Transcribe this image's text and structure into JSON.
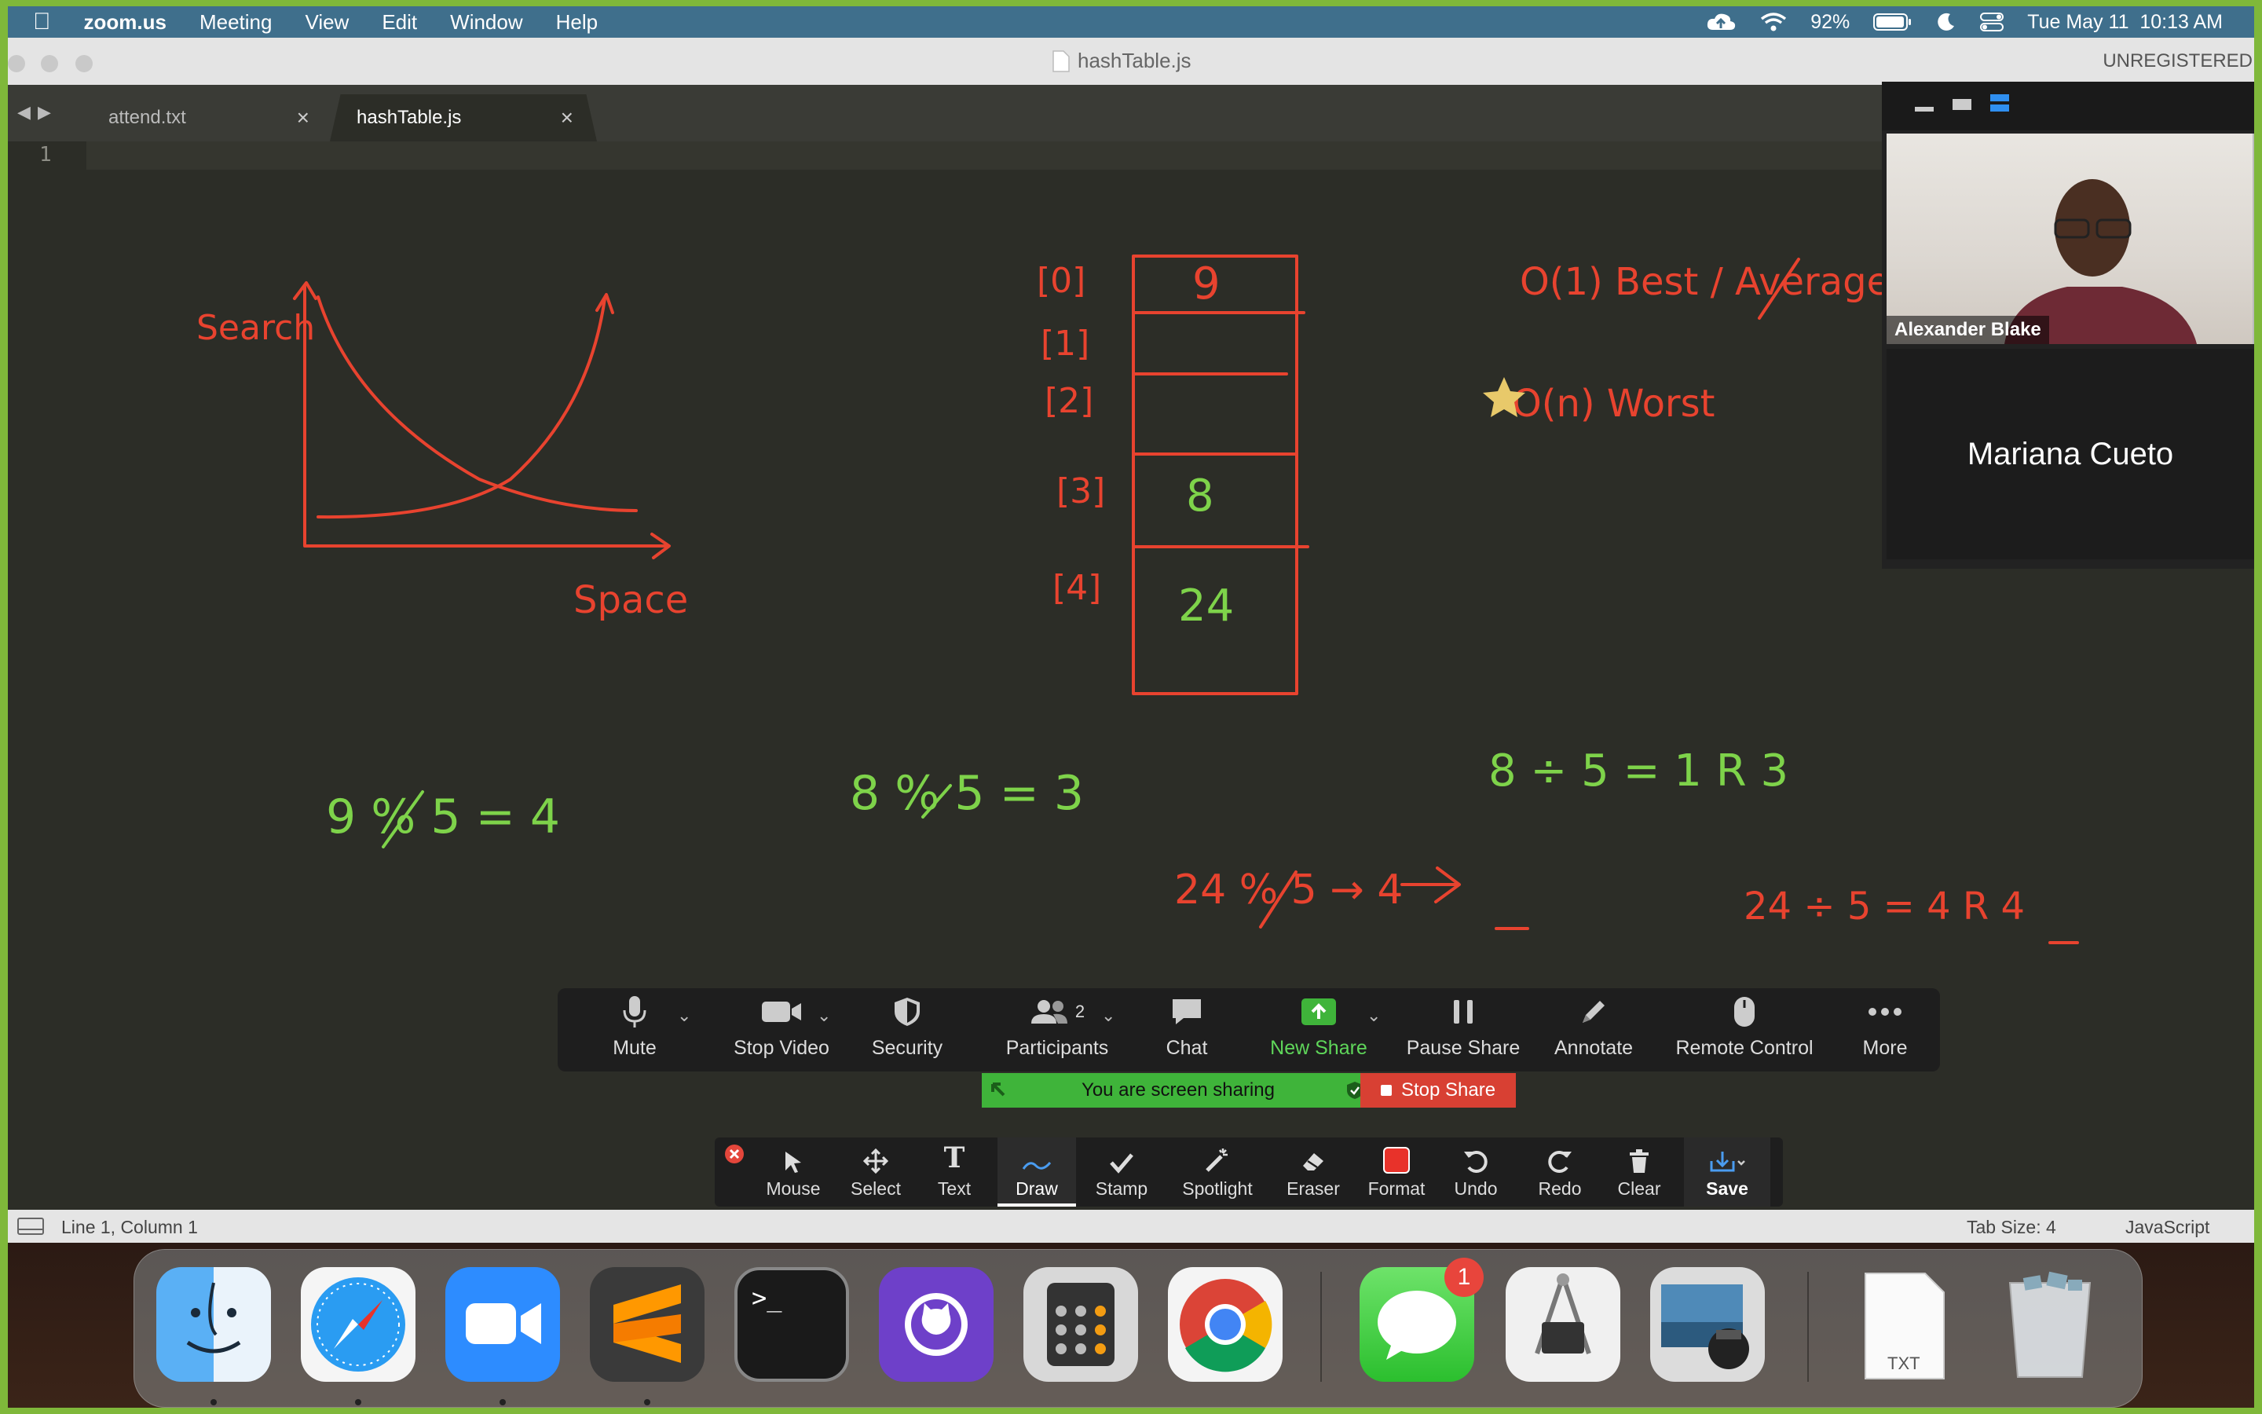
{
  "menubar": {
    "app": "zoom.us",
    "items": [
      "Meeting",
      "View",
      "Edit",
      "Window",
      "Help"
    ],
    "battery": "92%",
    "datetime": "Tue May 11  10:13 AM"
  },
  "window": {
    "title": "hashTable.js",
    "registration": "UNREGISTERED",
    "tabs": [
      {
        "label": "attend.txt",
        "active": false
      },
      {
        "label": "hashTable.js",
        "active": true
      }
    ],
    "line_number": "1"
  },
  "drawing": {
    "graph_y_label": "Search",
    "graph_x_label": "Space",
    "table_indices": [
      "[0]",
      "[1]",
      "[2]",
      "[3]",
      "[4]"
    ],
    "table_values": [
      "9",
      "",
      "",
      "8",
      "24"
    ],
    "complexity_best": "O(1) Best / Average",
    "complexity_worst": "O(n) Worst",
    "eq1": "9 % 5 = 4",
    "eq2": "8 % 5 = 3",
    "eq3": "8 ÷ 5 = 1 R 3",
    "eq4": "24 % 5 → 4",
    "eq5": "24 ÷ 5 = 4 R 4",
    "ink_red": "#e8432f",
    "ink_green": "#7ed34a"
  },
  "video": {
    "participant_1": "Alexander Blake",
    "participant_2": "Mariana Cueto"
  },
  "zoom_toolbar": {
    "buttons": [
      "Mute",
      "Stop Video",
      "Security",
      "Participants",
      "Chat",
      "New Share",
      "Pause Share",
      "Annotate",
      "Remote Control",
      "More"
    ],
    "participants_count": "2",
    "sharing_notice": "You are screen sharing",
    "stop_share": "Stop Share"
  },
  "annotate_toolbar": {
    "buttons": [
      "Mouse",
      "Select",
      "Text",
      "Draw",
      "Stamp",
      "Spotlight",
      "Eraser",
      "Format",
      "Undo",
      "Redo",
      "Clear",
      "Save"
    ],
    "active": "Draw"
  },
  "statusbar": {
    "position": "Line 1, Column 1",
    "tab_size": "Tab Size: 4",
    "syntax": "JavaScript"
  },
  "dock": {
    "apps": [
      "finder-icon",
      "safari-icon",
      "zoom-icon",
      "sublime-text-icon",
      "terminal-icon",
      "github-desktop-icon",
      "calculator-icon",
      "chrome-icon",
      "messages-icon",
      "system-information-icon",
      "preview-icon",
      "txt-document-icon",
      "trash-icon"
    ],
    "messages_badge": "1",
    "txt_label": "TXT"
  }
}
